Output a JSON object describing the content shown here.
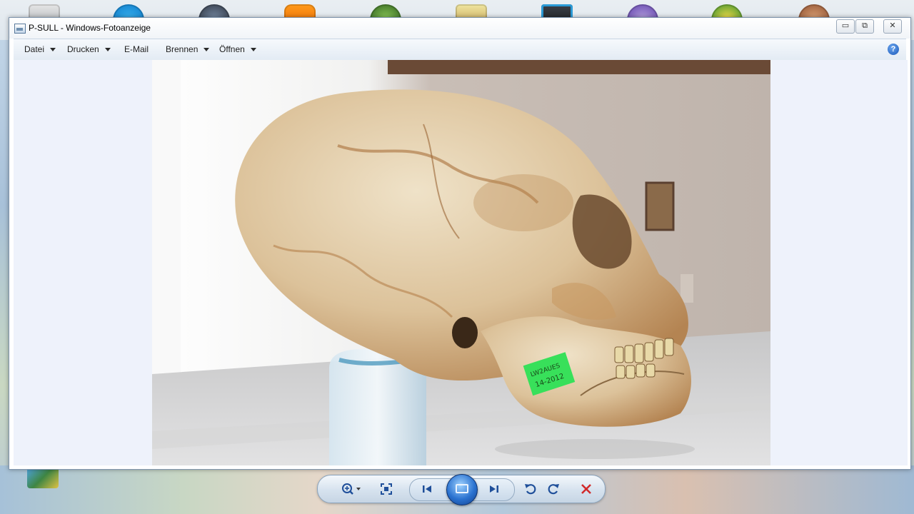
{
  "window": {
    "title": "P-SULL - Windows-Fotoanzeige",
    "minimize_label": "▭",
    "maximize_label": "⧉",
    "close_label": "✕"
  },
  "menu": {
    "items": [
      {
        "label": "Datei",
        "has_dropdown": true
      },
      {
        "label": "Drucken",
        "has_dropdown": true
      },
      {
        "label": "E-Mail",
        "has_dropdown": false
      },
      {
        "label": "Brennen",
        "has_dropdown": true
      },
      {
        "label": "Öffnen",
        "has_dropdown": true
      }
    ],
    "help_label": "?"
  },
  "photo": {
    "label_text_line1": "LW2AUES",
    "label_text_line2": "14-2012"
  },
  "controls": {
    "zoom_icon": "zoom-icon",
    "fit_icon": "actual-size-icon",
    "previous_icon": "previous-icon",
    "slideshow_icon": "slideshow-icon",
    "next_icon": "next-icon",
    "rotate_left_icon": "rotate-counterclockwise-icon",
    "rotate_right_icon": "rotate-clockwise-icon",
    "delete_icon": "delete-icon"
  },
  "colors": {
    "accent": "#1f4f9a",
    "delete": "#d12a2a",
    "viewer_bg": "#eef2fb"
  }
}
